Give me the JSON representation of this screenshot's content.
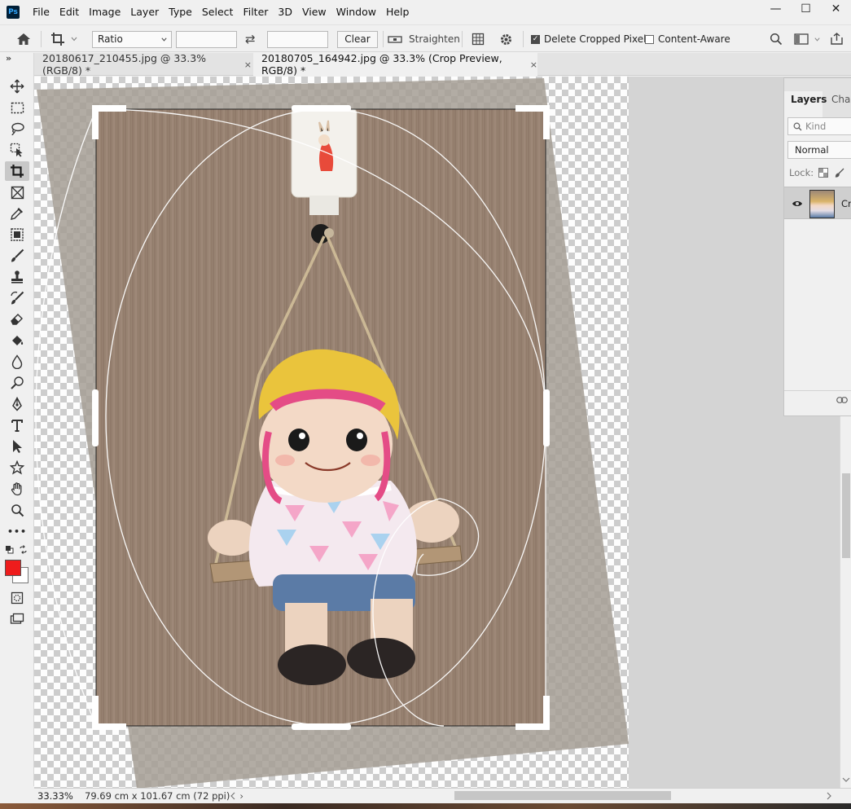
{
  "app": {
    "logo": "Ps"
  },
  "menu": [
    "File",
    "Edit",
    "Image",
    "Layer",
    "Type",
    "Select",
    "Filter",
    "3D",
    "View",
    "Window",
    "Help"
  ],
  "window_controls": {
    "minimize": "—",
    "maximize": "☐",
    "close": "✕"
  },
  "options_bar": {
    "ratio_label": "Ratio",
    "width_value": "",
    "height_value": "",
    "swap_icon": "⇄",
    "clear_label": "Clear",
    "straighten_label": "Straighten",
    "delete_cropped_label": "Delete Cropped Pixels",
    "delete_cropped_checked": true,
    "content_aware_label": "Content-Aware",
    "content_aware_checked": false
  },
  "tabs": [
    {
      "label": "20180617_210455.jpg @ 33.3% (RGB/8) *",
      "close": "×",
      "active": false
    },
    {
      "label": "20180705_164942.jpg @ 33.3% (Crop Preview, RGB/8) *",
      "close": "×",
      "active": true
    }
  ],
  "toolbar": {
    "collapse": "»",
    "more": "•••"
  },
  "colors": {
    "foreground": "#ee1c1c",
    "background": "#ffffff",
    "accent": "#1473e6"
  },
  "layers_panel": {
    "tabs": [
      "Layers",
      "Char"
    ],
    "search_placeholder": "Kind",
    "blend_mode": "Normal",
    "lock_label": "Lock:",
    "layer_name": "Cro"
  },
  "status": {
    "zoom": "33.33%",
    "doc_info": "79.69 cm x 101.67 cm (72 ppi)",
    "arrow": "›"
  }
}
